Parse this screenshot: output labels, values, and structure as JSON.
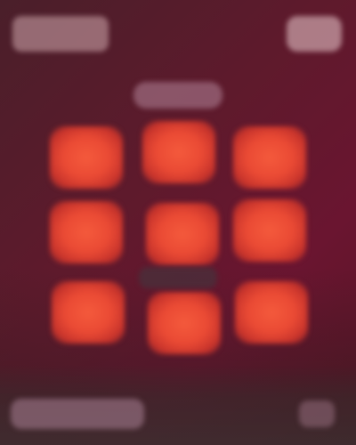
{
  "theme": {
    "background": "#5e1a2c",
    "accent": "#ea4a34",
    "accent_highlight": "#f45a3c"
  },
  "header": {
    "logo_text": "",
    "menu_icon": "menu-icon"
  },
  "main": {
    "title": "",
    "middle_label": "",
    "tiles": [
      {
        "label": ""
      },
      {
        "label": ""
      },
      {
        "label": ""
      },
      {
        "label": ""
      },
      {
        "label": ""
      },
      {
        "label": ""
      },
      {
        "label": ""
      },
      {
        "label": ""
      },
      {
        "label": ""
      }
    ]
  },
  "footer": {
    "field_placeholder": "",
    "action_icon": "action-icon"
  }
}
